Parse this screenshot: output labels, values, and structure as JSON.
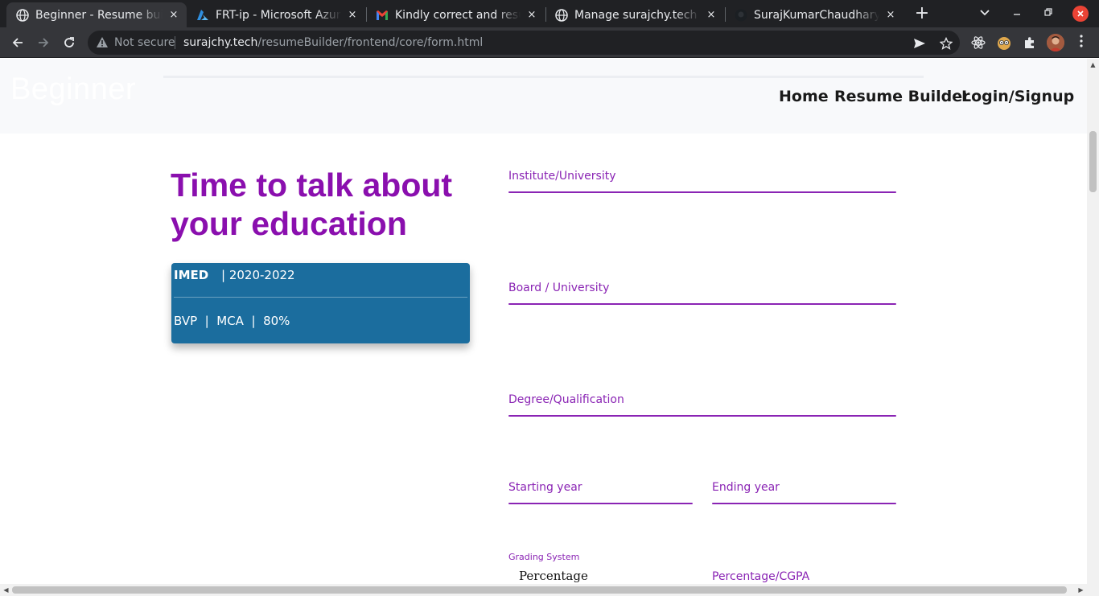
{
  "browser": {
    "tabs": [
      {
        "title": "Beginner - Resume builder",
        "icon": "globe-icon",
        "active": true
      },
      {
        "title": "FRT-ip - Microsoft Azure",
        "icon": "azure-icon",
        "active": false
      },
      {
        "title": "Kindly correct and resubmit",
        "icon": "gmail-icon",
        "active": false
      },
      {
        "title": "Manage surajchy.tech",
        "icon": "globe-icon",
        "active": false
      },
      {
        "title": "SurajKumarChaudhary/Resume",
        "icon": "github-icon",
        "active": false
      }
    ],
    "new_tab": "+",
    "close_tab": "×",
    "security_label": "Not secure",
    "url_host": "surajchy.tech",
    "url_path": "/resumeBuilder/frontend/core/form.html"
  },
  "site": {
    "brand": "Beginner",
    "nav": [
      "Home",
      "Resume Builder",
      "Login/Signup"
    ]
  },
  "main": {
    "heading": "Time to talk about your education",
    "card": {
      "institute": "IMED",
      "years": "| 2020-2022",
      "details": "BVP  |  MCA  |  80%"
    },
    "fields": {
      "institute": "Institute/University",
      "board": "Board / University",
      "degree": "Degree/Qualification",
      "start_year": "Starting year",
      "end_year": "Ending year",
      "grading_label": "Grading System",
      "grading_value": "Percentage",
      "score": "Percentage/CGPA"
    }
  },
  "colors": {
    "accent": "#8a24b4",
    "heading": "#8a0fae",
    "card": "#1b6d9e",
    "chrome_dark": "#202124",
    "chrome_tab": "#35363a"
  }
}
